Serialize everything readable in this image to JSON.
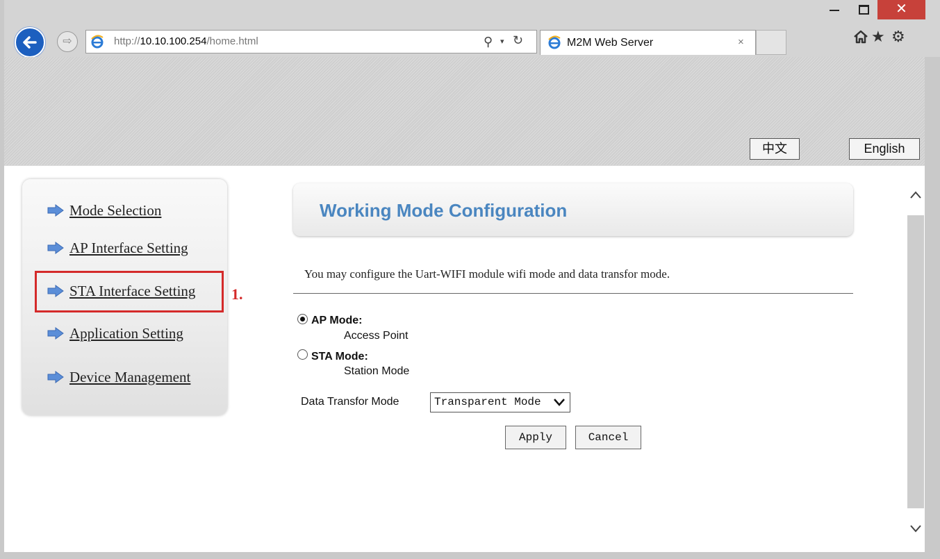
{
  "window": {
    "close_glyph": "✕"
  },
  "browser": {
    "url_prefix": "http://",
    "url_host": "10.10.100.254",
    "url_path": "/home.html",
    "search_glyph": "⚲",
    "dropdown_glyph": "▾",
    "refresh_glyph": "↻",
    "tab_title": "M2M Web Server",
    "tab_close_glyph": "×",
    "icons": [
      "back-icon",
      "forward-icon",
      "ie-icon",
      "search-icon",
      "refresh-icon",
      "home-icon",
      "star-icon",
      "gear-icon"
    ],
    "star_glyph": "★",
    "gear_glyph": "⚙"
  },
  "banner": {
    "lang_chinese": "中文",
    "lang_english": "English"
  },
  "sidebar": {
    "items": [
      {
        "label": "Mode Selection"
      },
      {
        "label": "AP Interface Setting"
      },
      {
        "label": "STA Interface Setting"
      },
      {
        "label": "Application Setting"
      },
      {
        "label": "Device Management"
      }
    ],
    "highlight_color": "#d42a2a",
    "step_label": "1."
  },
  "main": {
    "title": "Working Mode Configuration",
    "description": "You may configure the Uart-WIFI module wifi mode and data transfor mode.",
    "modes": [
      {
        "title": "AP Mode:",
        "desc": "Access Point",
        "checked": true
      },
      {
        "title": "STA Mode:",
        "desc": "Station Mode",
        "checked": false
      }
    ],
    "transfor_label": "Data Transfor Mode",
    "transfor_value": "Transparent Mode",
    "apply_label": "Apply",
    "cancel_label": "Cancel"
  },
  "colors": {
    "title_blue": "#4a86c0",
    "link_arrow_blue": "#5b8ed8",
    "close_red": "#c7413a"
  }
}
